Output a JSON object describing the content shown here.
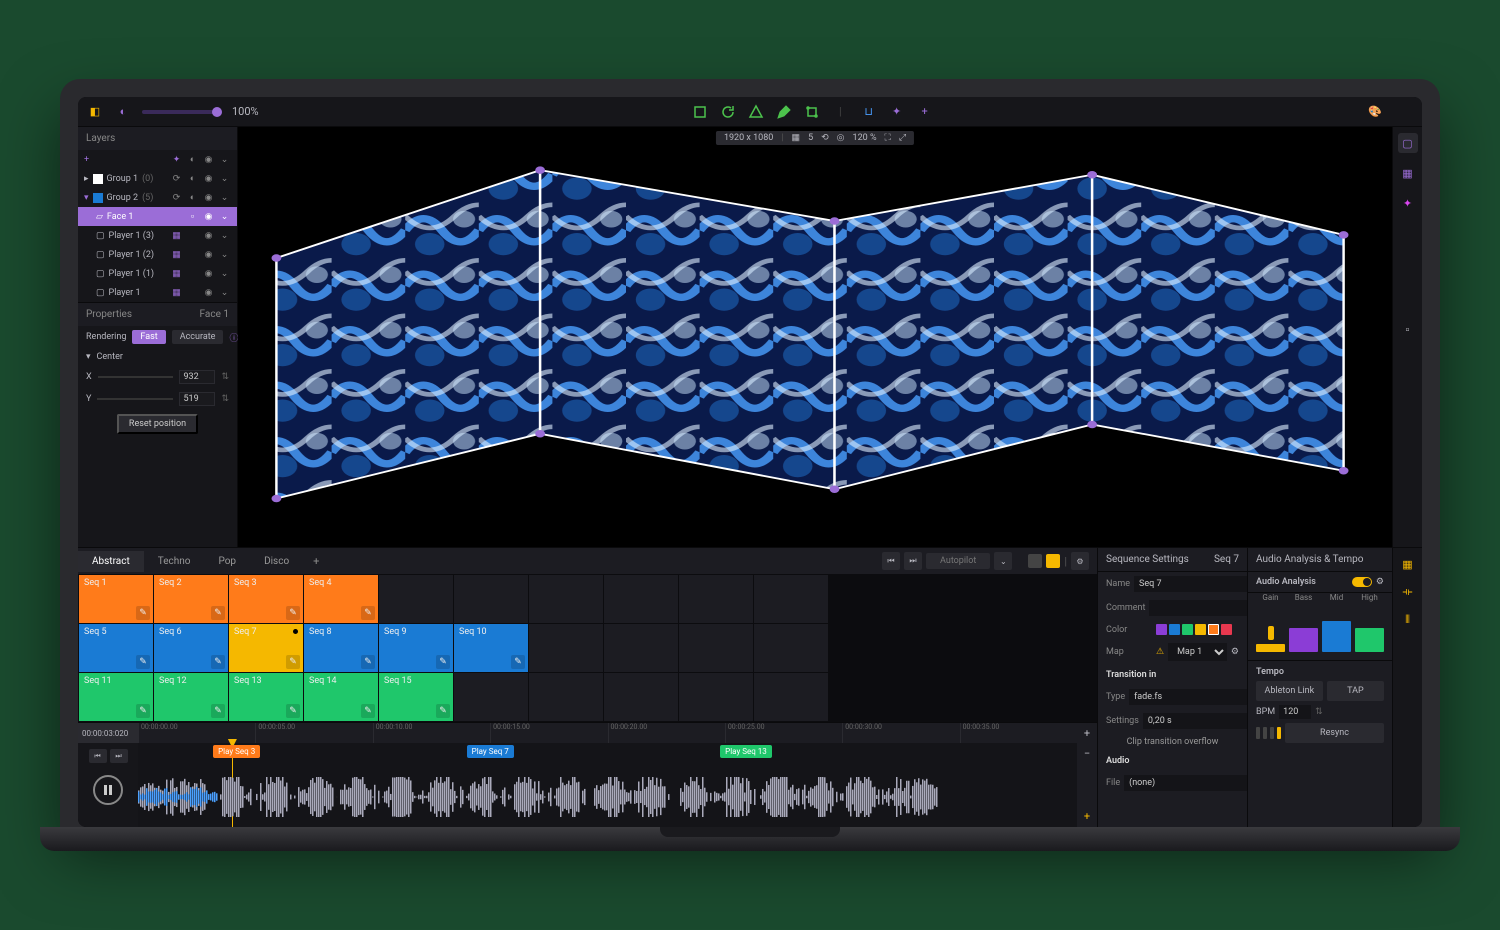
{
  "topbar": {
    "zoom": "100%",
    "canvas_size": "1920 x 1080",
    "grid_n": "5",
    "view_zoom": "120 %"
  },
  "layers": {
    "title": "Layers",
    "items": [
      {
        "name": "Group 1",
        "count": "(0)"
      },
      {
        "name": "Group 2",
        "count": "(5)"
      },
      {
        "name": "Face 1"
      },
      {
        "name": "Player 1 (3)"
      },
      {
        "name": "Player 1 (2)"
      },
      {
        "name": "Player 1 (1)"
      },
      {
        "name": "Player 1"
      }
    ]
  },
  "properties": {
    "title": "Properties",
    "target": "Face 1",
    "rendering_label": "Rendering",
    "fast": "Fast",
    "accurate": "Accurate",
    "center_label": "Center",
    "x_label": "X",
    "x_val": "932",
    "y_label": "Y",
    "y_val": "519",
    "reset": "Reset position"
  },
  "sequences": {
    "tabs": [
      "Abstract",
      "Techno",
      "Pop",
      "Disco"
    ],
    "autopilot": "Autopilot",
    "cells": [
      [
        {
          "l": "Seq 1",
          "c": "orange"
        },
        {
          "l": "Seq 2",
          "c": "orange"
        },
        {
          "l": "Seq 3",
          "c": "orange"
        },
        {
          "l": "Seq 4",
          "c": "orange"
        },
        {},
        {},
        {},
        {},
        {},
        {}
      ],
      [
        {
          "l": "Seq 5",
          "c": "blue"
        },
        {
          "l": "Seq 6",
          "c": "blue"
        },
        {
          "l": "Seq 7",
          "c": "yellow",
          "active": true
        },
        {
          "l": "Seq 8",
          "c": "blue"
        },
        {
          "l": "Seq 9",
          "c": "blue"
        },
        {
          "l": "Seq 10",
          "c": "blue"
        },
        {},
        {},
        {},
        {}
      ],
      [
        {
          "l": "Seq 11",
          "c": "green"
        },
        {
          "l": "Seq 12",
          "c": "green"
        },
        {
          "l": "Seq 13",
          "c": "green"
        },
        {
          "l": "Seq 14",
          "c": "green"
        },
        {
          "l": "Seq 15",
          "c": "green"
        },
        {},
        {},
        {},
        {},
        {}
      ]
    ]
  },
  "timeline": {
    "current": "00:00:03:020",
    "ticks": [
      "00:00:00.00",
      "00:00:05.00",
      "00:00:10.00",
      "00:00:15.00",
      "00:00:20.00",
      "00:00:25.00",
      "00:00:30.00",
      "00:00:35.00"
    ],
    "markers": [
      "Play Seq 3",
      "Play Seq 7",
      "Play Seq 13"
    ]
  },
  "seq_settings": {
    "title": "Sequence Settings",
    "target": "Seq 7",
    "name_label": "Name",
    "name_val": "Seq 7",
    "comment_label": "Comment",
    "color_label": "Color",
    "map_label": "Map",
    "map_val": "Map 1",
    "transition_title": "Transition in",
    "type_label": "Type",
    "type_val": "fade.fs",
    "settings_label": "Settings",
    "settings_val": "0,20 s",
    "overflow": "Clip transition overflow",
    "audio_title": "Audio",
    "file_label": "File",
    "file_val": "(none)"
  },
  "audio": {
    "title": "Audio Analysis & Tempo",
    "analysis": "Audio Analysis",
    "bands": [
      "Gain",
      "Bass",
      "Mid",
      "High"
    ],
    "tempo_title": "Tempo",
    "ableton": "Ableton Link",
    "tap": "TAP",
    "bpm_label": "BPM",
    "bpm_val": "120",
    "resync": "Resync"
  }
}
